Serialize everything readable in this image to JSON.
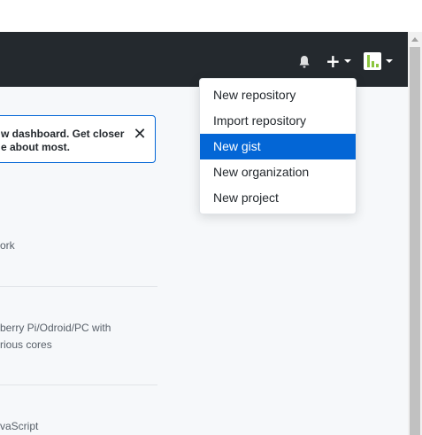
{
  "header": {
    "bell_icon": "bell-icon",
    "plus_glyph": "+",
    "avatar_icon": "user-avatar"
  },
  "notice": {
    "text": "w dashboard. Get closer\ne about most.",
    "close_glyph": "✕"
  },
  "feed": [
    {
      "text": "ork"
    },
    {
      "text": "berry Pi/Odroid/PC with\nrious cores"
    },
    {
      "text": "vaScript"
    }
  ],
  "dropdown": {
    "items": [
      {
        "label": "New repository"
      },
      {
        "label": "Import repository"
      },
      {
        "label": "New gist",
        "selected": true
      },
      {
        "label": "New organization"
      },
      {
        "label": "New project"
      }
    ]
  },
  "colors": {
    "header_bg": "#24292e",
    "accent": "#0366d6",
    "content_bg": "#f6f8fa",
    "avatar_green": "#8cc63f"
  }
}
